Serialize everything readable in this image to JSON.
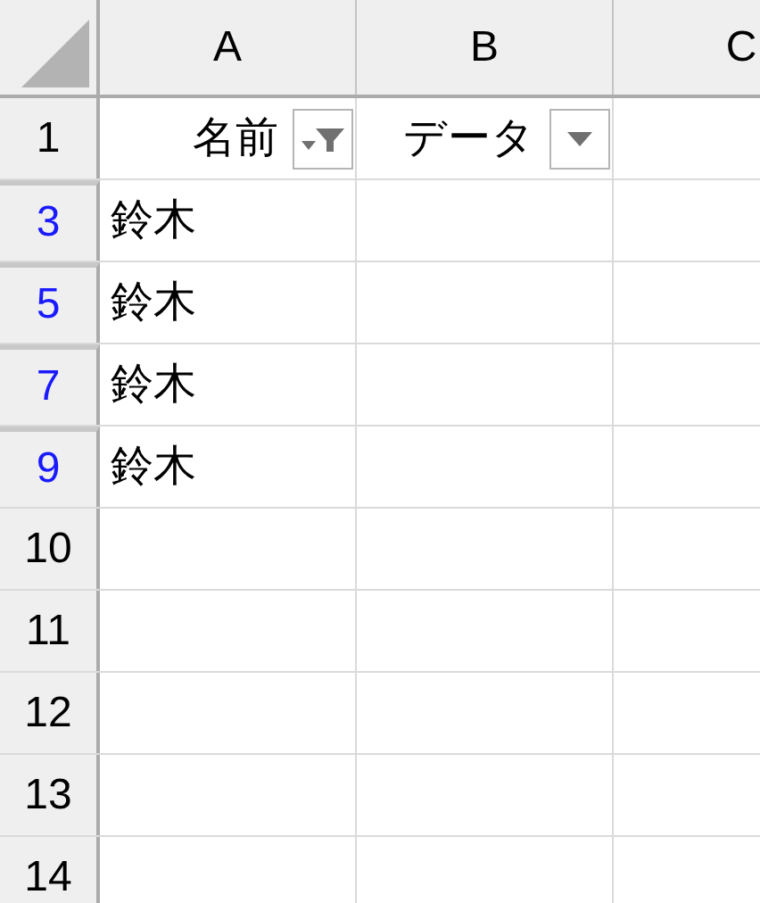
{
  "columns": [
    {
      "label": "A"
    },
    {
      "label": "B"
    },
    {
      "label": "C"
    }
  ],
  "rows": [
    {
      "number": "1",
      "filtered": false,
      "after_hidden": false,
      "cells": [
        {
          "text": "名前",
          "filter_applied": true
        },
        {
          "text": "データ",
          "filter_applied": false
        }
      ]
    },
    {
      "number": "3",
      "filtered": true,
      "after_hidden": true,
      "cells": [
        {
          "text": "鈴木"
        }
      ]
    },
    {
      "number": "5",
      "filtered": true,
      "after_hidden": true,
      "cells": [
        {
          "text": "鈴木"
        }
      ]
    },
    {
      "number": "7",
      "filtered": true,
      "after_hidden": true,
      "cells": [
        {
          "text": "鈴木"
        }
      ]
    },
    {
      "number": "9",
      "filtered": true,
      "after_hidden": true,
      "cells": [
        {
          "text": "鈴木"
        }
      ]
    },
    {
      "number": "10",
      "filtered": false,
      "after_hidden": false
    },
    {
      "number": "11",
      "filtered": false,
      "after_hidden": false
    },
    {
      "number": "12",
      "filtered": false,
      "after_hidden": false
    },
    {
      "number": "13",
      "filtered": false,
      "after_hidden": false
    },
    {
      "number": "14",
      "filtered": false,
      "after_hidden": false
    }
  ]
}
